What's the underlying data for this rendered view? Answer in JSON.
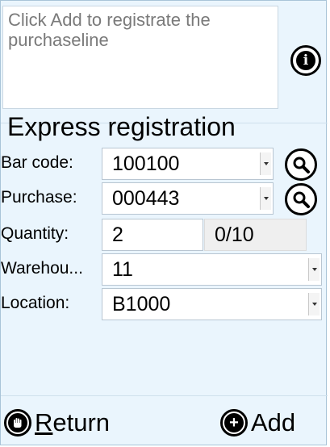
{
  "message": {
    "text": "Click Add to registrate the purchaseline"
  },
  "icons": {
    "info": "info-icon",
    "search": "search-icon",
    "return": "hand-stop-icon",
    "add": "plus-circle-icon"
  },
  "form": {
    "title": "Express registration",
    "barcode": {
      "label": "Bar code:",
      "value": "100100"
    },
    "purchase": {
      "label": "Purchase:",
      "value": "000443"
    },
    "quantity": {
      "label": "Quantity:",
      "value": "2",
      "progress": "0/10"
    },
    "warehouse": {
      "label": "Warehou...",
      "value": "11"
    },
    "location": {
      "label": "Location:",
      "value": "B1000"
    }
  },
  "buttons": {
    "return_label": "Return",
    "add_label": "Add"
  },
  "colors": {
    "background": "#eaf5fd",
    "field": "#ffffff",
    "readonly_field": "#efefef"
  }
}
